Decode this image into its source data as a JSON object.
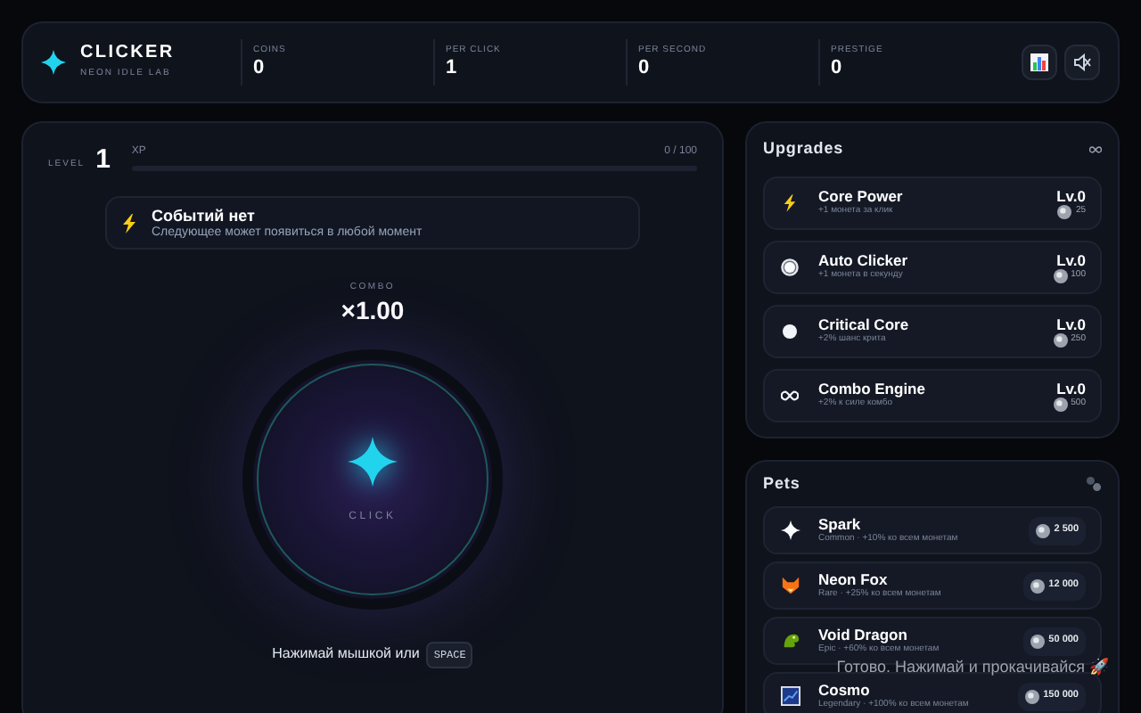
{
  "brand": {
    "title": "CLICKER",
    "subtitle": "NEON IDLE LAB"
  },
  "stats": [
    {
      "label": "COINS",
      "value": "0"
    },
    {
      "label": "PER CLICK",
      "value": "1"
    },
    {
      "label": "PER SECOND",
      "value": "0"
    },
    {
      "label": "PRESTIGE",
      "value": "0"
    }
  ],
  "level": {
    "label": "LEVEL",
    "value": "1",
    "xp_label": "XP",
    "xp_reading": "0 / 100",
    "level": 0
  },
  "event": {
    "title": "Событий нет",
    "text": "Следующее может появиться в любой момент"
  },
  "combo": {
    "label": "COMBO",
    "value": "×1.00"
  },
  "click_button": {
    "label": "CLICK"
  },
  "hint": {
    "text": "Нажимай мышкой или",
    "key": "SPACE"
  },
  "upgrades": {
    "title": "Upgrades",
    "items": [
      {
        "kind": "bolt",
        "name": "Core Power",
        "desc": "+1 монета за клик",
        "level_text": "Lv.0",
        "price": "25"
      },
      {
        "kind": "ring",
        "name": "Auto Clicker",
        "desc": "+1 монета в секунду",
        "level_text": "Lv.0",
        "price": "100"
      },
      {
        "kind": "dot",
        "name": "Critical Core",
        "desc": "+2% шанс крита",
        "level_text": "Lv.0",
        "price": "250"
      },
      {
        "kind": "infinity",
        "name": "Combo Engine",
        "desc": "+2% к силе комбо",
        "level_text": "Lv.0",
        "price": "500"
      }
    ]
  },
  "pets": {
    "title": "Pets",
    "items": [
      {
        "kind": "spark",
        "name": "Spark",
        "desc": "Common · +10% ко всем монетам",
        "price": "2 500"
      },
      {
        "kind": "fox",
        "name": "Neon Fox",
        "desc": "Rare · +25% ко всем монетам",
        "price": "12 000"
      },
      {
        "kind": "dragon",
        "name": "Void Dragon",
        "desc": "Epic · +60% ко всем монетам",
        "price": "50 000"
      },
      {
        "kind": "cosmo",
        "name": "Cosmo",
        "desc": "Legendary · +100% ко всем монетам",
        "price": "150 000"
      }
    ]
  },
  "toast": {
    "text": "Готово. Нажимай и прокачивайся 🚀"
  }
}
